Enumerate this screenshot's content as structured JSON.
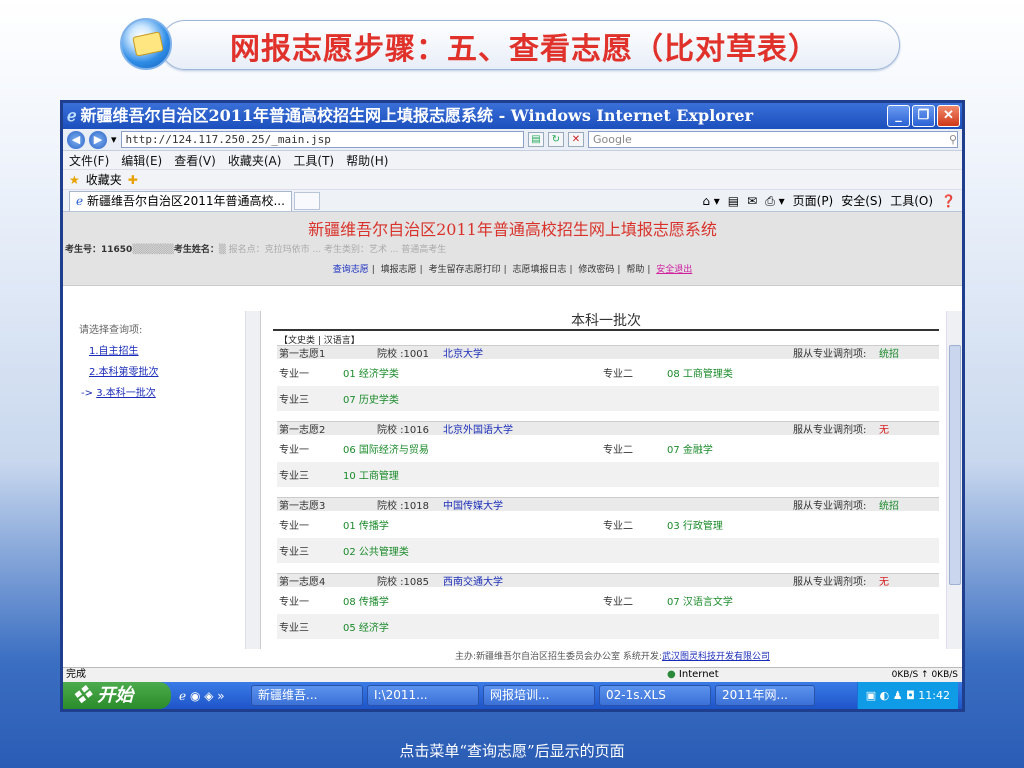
{
  "slide": {
    "title": "网报志愿步骤：五、查看志愿（比对草表）",
    "caption": "点击菜单“查询志愿”后显示的页面"
  },
  "window": {
    "title": "新疆维吾尔自治区2011年普通高校招生网上填报志愿系统 - Windows Internet Explorer",
    "url": "http://124.117.250.25/_main.jsp",
    "search_placeholder": "Google",
    "menus": [
      "文件(F)",
      "编辑(E)",
      "查看(V)",
      "收藏夹(A)",
      "工具(T)",
      "帮助(H)"
    ],
    "favorites_label": "收藏夹",
    "tab_label": "新疆维吾尔自治区2011年普通高校...",
    "commands": [
      "页面(P)",
      "安全(S)",
      "工具(O)"
    ]
  },
  "page": {
    "system_title": "新疆维吾尔自治区2011年普通高校招生网上填报志愿系统",
    "student_info": "考生号：11650",
    "student_name_label": "考生姓名：",
    "student_detail": "报名点：克拉玛依市 ... 考生类别：艺术 ... 普通高考生",
    "nav": [
      "查询志愿",
      "填报志愿",
      "考生留存志愿打印",
      "志愿填报日志",
      "修改密码",
      "帮助",
      "安全退出"
    ],
    "left": {
      "heading": "请选择查询项:",
      "items": [
        "1.自主招生",
        "2.本科第零批次",
        "3.本科一批次"
      ],
      "current_marker": "->"
    },
    "batch_title": "本科一批次",
    "subject": "【文史类 | 汉语言】",
    "choices": [
      {
        "label": "第一志愿1",
        "school_code": "院校 :1001",
        "school": "北京大学",
        "adjust_label": "服从专业调剂项:",
        "adjust": "统招",
        "major1_label": "专业一",
        "major1": "01 经济学类",
        "major2_label": "专业二",
        "major2": "08 工商管理类",
        "major3_label": "专业三",
        "major3": "07 历史学类"
      },
      {
        "label": "第一志愿2",
        "school_code": "院校 :1016",
        "school": "北京外国语大学",
        "adjust_label": "服从专业调剂项:",
        "adjust": "无",
        "major1_label": "专业一",
        "major1": "06 国际经济与贸易",
        "major2_label": "专业二",
        "major2": "07 金融学",
        "major3_label": "专业三",
        "major3": "10 工商管理"
      },
      {
        "label": "第一志愿3",
        "school_code": "院校 :1018",
        "school": "中国传媒大学",
        "adjust_label": "服从专业调剂项:",
        "adjust": "统招",
        "major1_label": "专业一",
        "major1": "01 传播学",
        "major2_label": "专业二",
        "major2": "03 行政管理",
        "major3_label": "专业三",
        "major3": "02 公共管理类"
      },
      {
        "label": "第一志愿4",
        "school_code": "院校 :1085",
        "school": "西南交通大学",
        "adjust_label": "服从专业调剂项:",
        "adjust": "无",
        "major1_label": "专业一",
        "major1": "08 传播学",
        "major2_label": "专业二",
        "major2": "07 汉语言文学",
        "major3_label": "专业三",
        "major3": "05 经济学"
      }
    ],
    "sponsor": "主办:新疆维吾尔自治区招生委员会办公室   系统开发:",
    "sponsor_link": "武汉图灵科技开发有限公司"
  },
  "status": {
    "text": "完成",
    "zone": "Internet",
    "rate": "0KB/S ↑  0KB/S"
  },
  "taskbar": {
    "start": "开始",
    "items": [
      "新疆维吾...",
      "I:\\2011...",
      "网报培训...",
      "02-1s.XLS",
      "2011年网..."
    ],
    "time": "11:42"
  }
}
